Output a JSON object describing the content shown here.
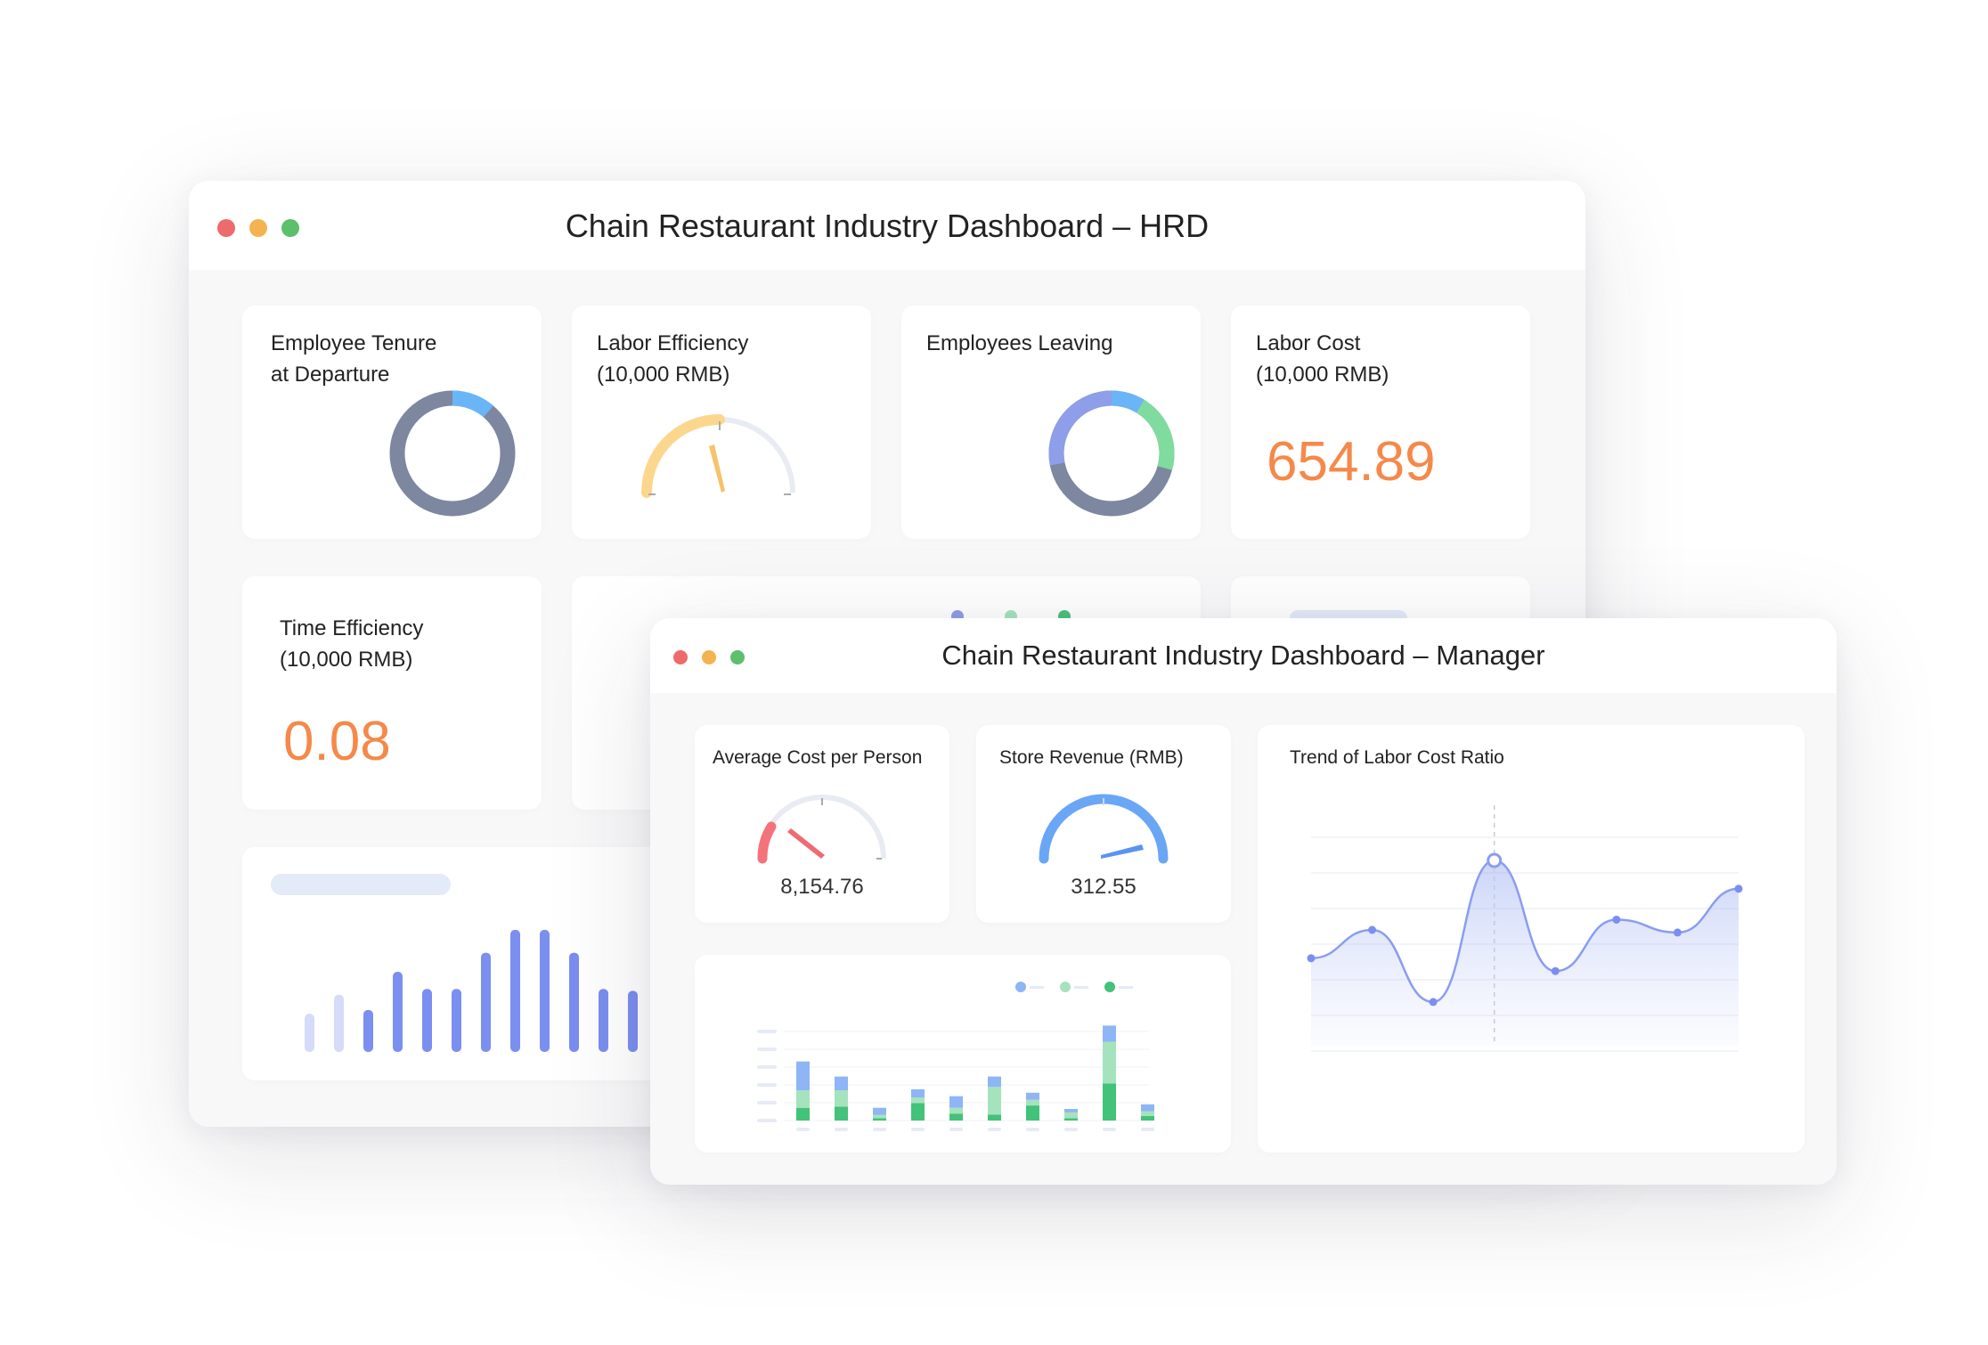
{
  "hrd": {
    "title": "Chain Restaurant Industry Dashboard – HRD",
    "cards": {
      "tenure": {
        "label_line1": "Employee Tenure",
        "label_line2": "at Departure"
      },
      "efficiency": {
        "label_line1": "Labor Efficiency",
        "label_line2": "(10,000 RMB)"
      },
      "leaving": {
        "label_line1": "Employees Leaving"
      },
      "labor_cost": {
        "label_line1": "Labor Cost",
        "label_line2": "(10,000 RMB)",
        "value": "654.89"
      },
      "time_eff": {
        "label_line1": "Time Efficiency",
        "label_line2": "(10,000 RMB)",
        "value": "0.08"
      }
    },
    "colors": {
      "accent_value": "#f5894a",
      "donut_gray": "#7d879f",
      "donut_blue": "#6ab4f8",
      "donut_green": "#7fdb9e",
      "bar": "#7b8ff0"
    }
  },
  "manager": {
    "title": "Chain Restaurant Industry Dashboard – Manager",
    "cards": {
      "avg_cost": {
        "label": "Average Cost per Person",
        "value": "8,154.76"
      },
      "store_rev": {
        "label": "Store Revenue (RMB)",
        "value": "312.55"
      },
      "trend": {
        "label": "Trend of Labor Cost Ratio"
      }
    }
  },
  "chart_data": [
    {
      "type": "bar",
      "values": [
        2,
        3,
        2.2,
        4.2,
        3.3,
        3.3,
        5.2,
        6.4,
        6.4,
        5.2,
        3.3,
        3.2,
        4.2
      ],
      "ylim": [
        0,
        7
      ]
    },
    {
      "type": "bar",
      "stacked": true,
      "series": [
        {
          "values": [
            1.1,
            1.2,
            0.2,
            1.5,
            0.6,
            0.5,
            1.3,
            0.2,
            3.2,
            0.4
          ]
        },
        {
          "values": [
            1.5,
            1.4,
            0.3,
            0.5,
            0.5,
            2.4,
            0.5,
            0.5,
            3.6,
            0.4
          ]
        },
        {
          "values": [
            2.5,
            1.2,
            0.6,
            0.7,
            1.0,
            0.9,
            0.6,
            0.3,
            1.4,
            0.6
          ]
        }
      ]
    },
    {
      "type": "line",
      "values": [
        3.4,
        4.5,
        1.7,
        7.2,
        2.9,
        4.9,
        4.4,
        6.1
      ],
      "ylim": [
        0,
        9
      ]
    }
  ]
}
